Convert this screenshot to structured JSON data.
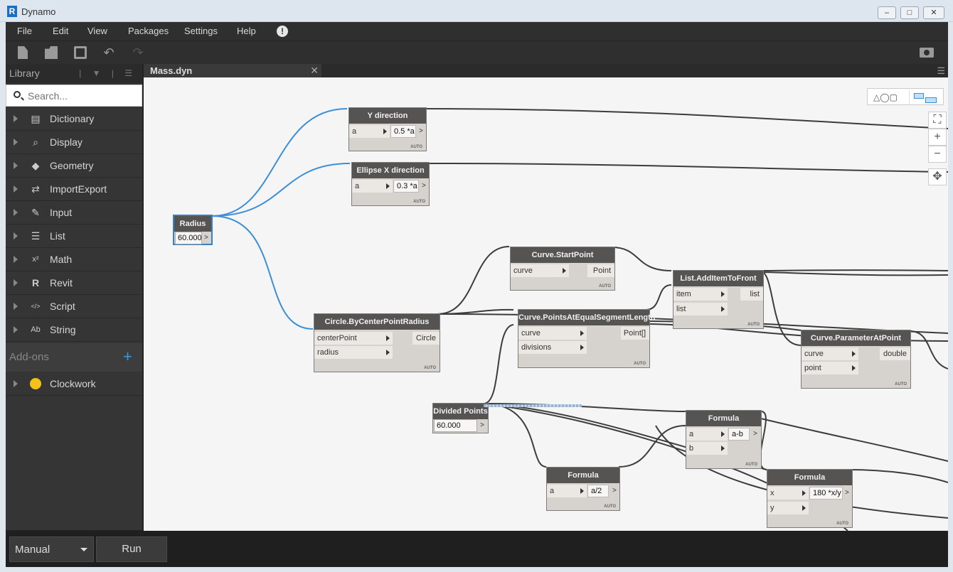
{
  "window": {
    "title": "Dynamo",
    "logo": "R",
    "controls": [
      "–",
      "□",
      "✕"
    ]
  },
  "menu": {
    "file": "File",
    "edit": "Edit",
    "view": "View",
    "packages": "Packages",
    "settings": "Settings",
    "help": "Help",
    "alert": "!"
  },
  "toolbar": {
    "undo": "↶",
    "redo": "↷"
  },
  "library": {
    "title": "Library",
    "search_placeholder": "Search...",
    "items": [
      {
        "label": "Dictionary",
        "icon": "book-icon",
        "glyph": "▤"
      },
      {
        "label": "Display",
        "icon": "magnifier-icon",
        "glyph": "⌕"
      },
      {
        "label": "Geometry",
        "icon": "cube-icon",
        "glyph": "◆"
      },
      {
        "label": "ImportExport",
        "icon": "swap-arrows-icon",
        "glyph": "⇄"
      },
      {
        "label": "Input",
        "icon": "pencil-icon",
        "glyph": "✎"
      },
      {
        "label": "List",
        "icon": "list-icon",
        "glyph": "☰"
      },
      {
        "label": "Math",
        "icon": "x-squared-icon",
        "glyph": "x²"
      },
      {
        "label": "Revit",
        "icon": "revit-icon",
        "glyph": "R"
      },
      {
        "label": "Script",
        "icon": "code-icon",
        "glyph": "</>"
      },
      {
        "label": "String",
        "icon": "text-icon",
        "glyph": "Ab"
      }
    ],
    "addons_label": "Add-ons",
    "addons_plus": "+",
    "addons": [
      {
        "label": "Clockwork",
        "icon": "clockwork-gear-icon"
      }
    ]
  },
  "tab": {
    "label": "Mass.dyn",
    "close": "✕",
    "menu": "☰"
  },
  "nodes": {
    "y_direction": {
      "title": "Y direction",
      "input": "a",
      "code": "0.5 *a",
      "out": ">",
      "lacing": "AUTO"
    },
    "ellipse_x": {
      "title": "Ellipse X direction",
      "input": "a",
      "code": "0.3 *a",
      "out": ">",
      "lacing": "AUTO"
    },
    "radius": {
      "title": "Radius",
      "value": "60.000",
      "out": ">"
    },
    "circle": {
      "title": "Circle.ByCenterPointRadius",
      "in1": "centerPoint",
      "in2": "radius",
      "out": "Circle",
      "lacing": "AUTO"
    },
    "start_point": {
      "title": "Curve.StartPoint",
      "in1": "curve",
      "out": "Point",
      "lacing": "AUTO"
    },
    "points_at": {
      "title": "Curve.PointsAtEqualSegmentLength",
      "in1": "curve",
      "in2": "divisions",
      "out": "Point[]",
      "lacing": "AUTO"
    },
    "add_item": {
      "title": "List.AddItemToFront",
      "in1": "item",
      "in2": "list",
      "out": "list",
      "lacing": "AUTO"
    },
    "param_at": {
      "title": "Curve.ParameterAtPoint",
      "in1": "curve",
      "in2": "point",
      "out": "double",
      "lacing": "AUTO"
    },
    "divided": {
      "title": "Divided Points",
      "value": "60.000",
      "out": ">"
    },
    "formula1": {
      "title": "Formula",
      "in1": "a",
      "in2": "b",
      "code": "a-b",
      "out": ">",
      "lacing": "AUTO"
    },
    "formula2": {
      "title": "Formula",
      "in1": "a",
      "code": "a/2",
      "out": ">",
      "lacing": "AUTO"
    },
    "formula3": {
      "title": "Formula",
      "in1": "x",
      "in2": "y",
      "code": "180 *x/y",
      "out": ">",
      "lacing": "AUTO"
    }
  },
  "view_controls": {
    "fit": "⛶",
    "zoom_in": "+",
    "zoom_out": "−",
    "pan": "✥"
  },
  "run": {
    "mode": "Manual",
    "button": "Run"
  },
  "colors": {
    "selected_wire": "#3a8fd6",
    "wire": "#3c3c3c",
    "node_header": "#555453"
  }
}
